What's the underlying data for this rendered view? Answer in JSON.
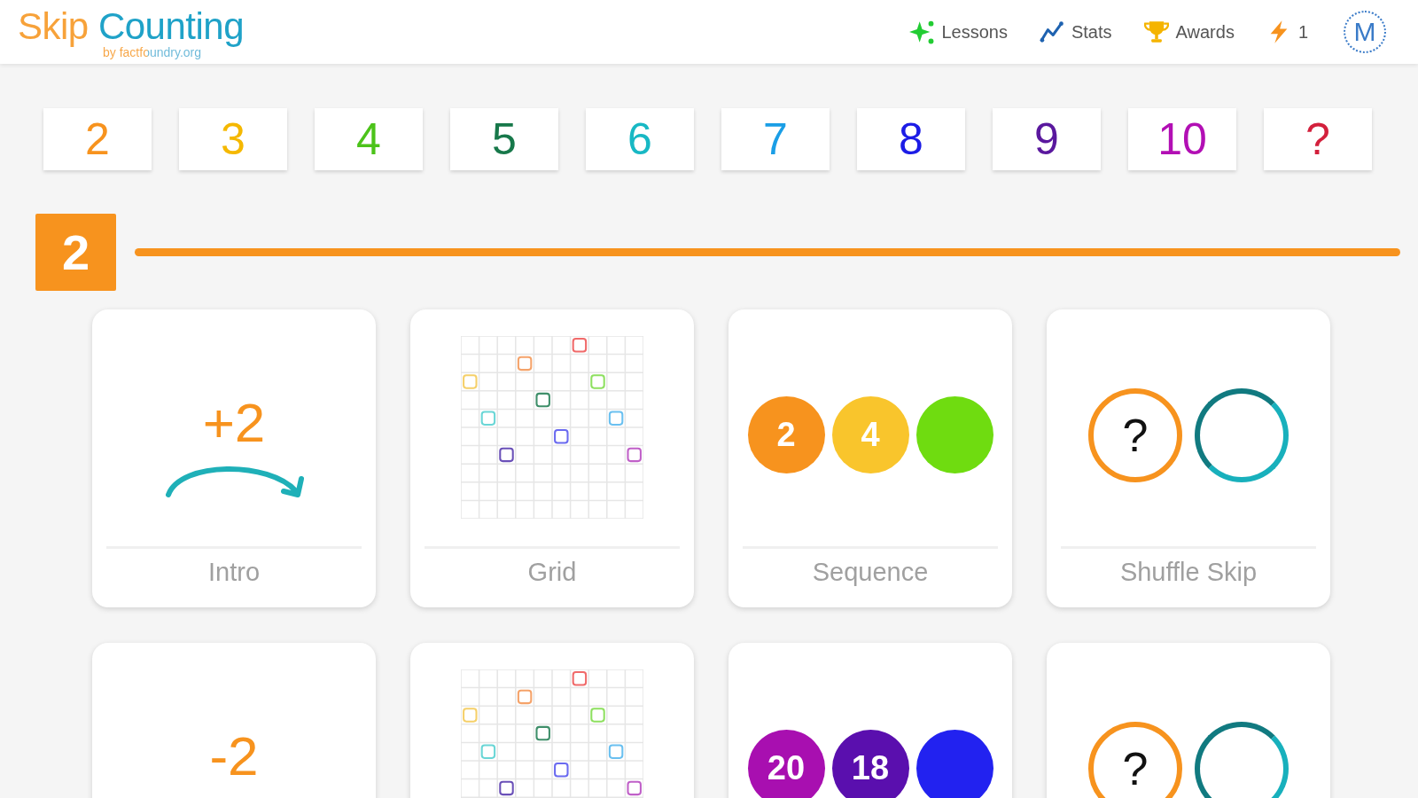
{
  "header": {
    "logo": {
      "first_word": "Skip",
      "second_word": "Counting",
      "byline": "by factfoundry.org"
    },
    "nav": [
      {
        "kind": "lessons",
        "label": "Lessons"
      },
      {
        "kind": "stats",
        "label": "Stats"
      },
      {
        "kind": "awards",
        "label": "Awards"
      }
    ],
    "streak": {
      "count": "1"
    },
    "avatar": {
      "initial": "M"
    }
  },
  "number_tiles": [
    {
      "label": "2",
      "color": "#f7931e"
    },
    {
      "label": "3",
      "color": "#f5b800"
    },
    {
      "label": "4",
      "color": "#4cc31a"
    },
    {
      "label": "5",
      "color": "#17784a"
    },
    {
      "label": "6",
      "color": "#18b8c4"
    },
    {
      "label": "7",
      "color": "#1a9ee6"
    },
    {
      "label": "8",
      "color": "#1c1ce6"
    },
    {
      "label": "9",
      "color": "#5a189e"
    },
    {
      "label": "10",
      "color": "#b20fb4"
    },
    {
      "label": "?",
      "color": "#d3203c"
    }
  ],
  "section": {
    "number": "2"
  },
  "activities": [
    {
      "kind": "intro",
      "text": "+2",
      "label": "Intro"
    },
    {
      "kind": "grid",
      "label": "Grid"
    },
    {
      "kind": "sequence",
      "label": "Sequence",
      "balls": [
        {
          "text": "2",
          "color": "#f7931e"
        },
        {
          "text": "4",
          "color": "#f9c52c"
        },
        {
          "color": "#6fdc10"
        }
      ]
    },
    {
      "kind": "shuffle",
      "mark": "?",
      "label": "Shuffle Skip"
    },
    {
      "kind": "intro",
      "text": "-2"
    },
    {
      "kind": "grid"
    },
    {
      "kind": "sequence",
      "balls": [
        {
          "text": "20",
          "color": "#a80fb0"
        },
        {
          "text": "18",
          "color": "#5a0fae"
        },
        {
          "color": "#2222f0"
        }
      ]
    },
    {
      "kind": "shuffle",
      "mark": "?"
    }
  ]
}
